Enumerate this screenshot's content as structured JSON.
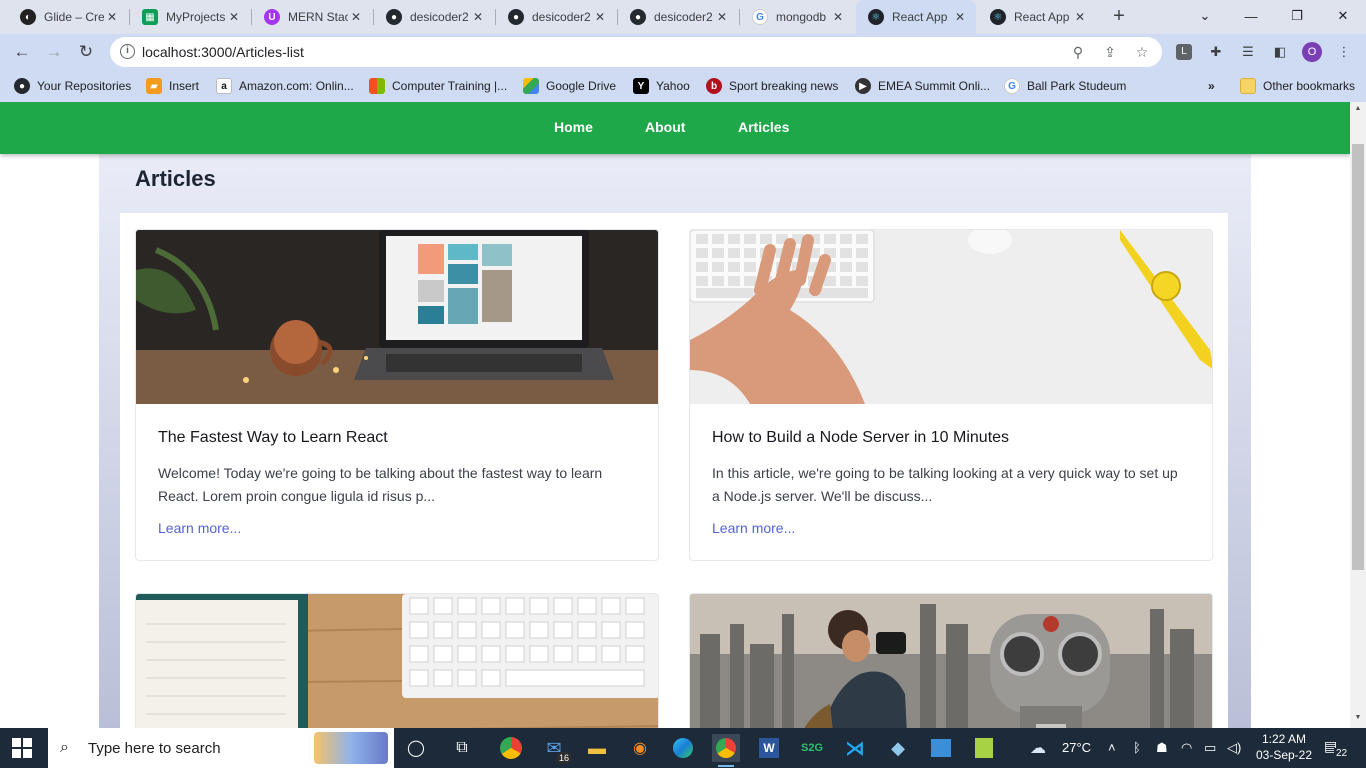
{
  "browser": {
    "tabs": [
      {
        "title": "Glide – Cre",
        "icon": "glide-icon",
        "active": false
      },
      {
        "title": "MyProjects",
        "icon": "sheets-icon",
        "active": false
      },
      {
        "title": "MERN Stac",
        "icon": "udemy-icon",
        "active": false
      },
      {
        "title": "desicoder2",
        "icon": "github-icon",
        "active": false
      },
      {
        "title": "desicoder2",
        "icon": "github-icon",
        "active": false
      },
      {
        "title": "desicoder2",
        "icon": "github-icon",
        "active": false
      },
      {
        "title": "mongodb",
        "icon": "google-icon",
        "active": false
      },
      {
        "title": "React App",
        "icon": "react-icon",
        "active": true
      },
      {
        "title": "React App",
        "icon": "react-icon",
        "active": false
      }
    ],
    "url": "localhost:3000/Articles-list",
    "profile_initial": "O",
    "bookmarks": [
      {
        "label": "Your Repositories",
        "icon": "github-icon"
      },
      {
        "label": "Insert",
        "icon": "insert-icon"
      },
      {
        "label": "Amazon.com: Onlin...",
        "icon": "amazon-icon"
      },
      {
        "label": "Computer Training |...",
        "icon": "microsoft-icon"
      },
      {
        "label": "Google Drive",
        "icon": "drive-icon"
      },
      {
        "label": "Yahoo",
        "icon": "yahoo-icon"
      },
      {
        "label": "Sport breaking news",
        "icon": "sport-icon"
      },
      {
        "label": "EMEA Summit Onli...",
        "icon": "play-icon"
      },
      {
        "label": "Ball Park Studeum",
        "icon": "google-icon"
      }
    ],
    "bookmarks_overflow": "»",
    "other_bookmarks": "Other bookmarks"
  },
  "site": {
    "nav": {
      "home": "Home",
      "about": "About",
      "articles": "Articles"
    },
    "page_title": "Articles",
    "articles": [
      {
        "title": "The Fastest Way to Learn React",
        "excerpt": "Welcome! Today we're going to be talking about the fastest way to learn React. Lorem proin congue ligula id risus p...",
        "link": "Learn more..."
      },
      {
        "title": "How to Build a Node Server in 10 Minutes",
        "excerpt": "In this article, we're going to be talking looking at a very quick way to set up a Node.js server. We'll be discuss...",
        "link": "Learn more..."
      }
    ]
  },
  "taskbar": {
    "search_placeholder": "Type here to search",
    "mail_badge": "16",
    "weather": "27°C",
    "time": "1:22 AM",
    "date": "03-Sep-22",
    "notifications": "22"
  },
  "colors": {
    "site_nav": "#1fa84a",
    "link": "#5463d6",
    "taskbar": "#1c2a3a",
    "browser_frame": "#cfdbf2"
  }
}
